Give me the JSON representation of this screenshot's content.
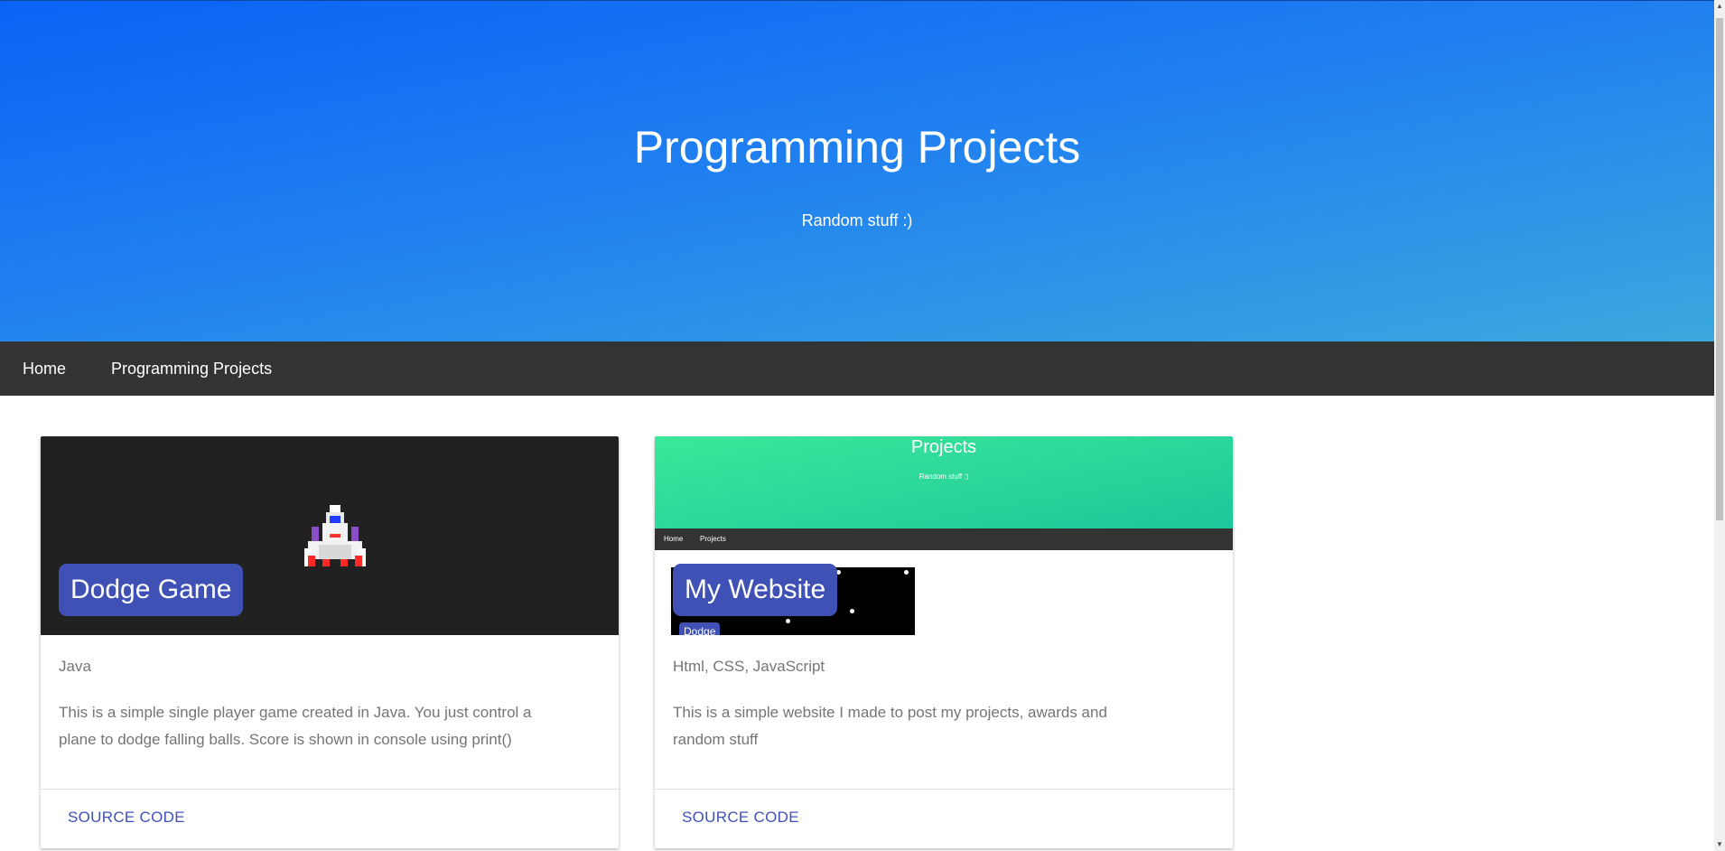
{
  "hero": {
    "title": "Programming Projects",
    "subtitle": "Random stuff :)",
    "gradient_colors": [
      "#0a63f5",
      "#3aa8de"
    ]
  },
  "nav": {
    "items": [
      {
        "label": "Home"
      },
      {
        "label": "Programming Projects"
      }
    ]
  },
  "projects": [
    {
      "title": "Dodge Game",
      "languages": "Java",
      "description": "This is a simple single player game created in Java. You just control a plane to dodge falling balls. Score is shown in console using print()",
      "action": "Source Code",
      "media_icon": "pixel-spaceship-icon"
    },
    {
      "title": "My Website",
      "languages": "Html, CSS, JavaScript",
      "description": "This is a simple website I made to post my projects, awards and random stuff",
      "action": "Source Code",
      "preview": {
        "title": "Projects",
        "subtitle": "Random stuff :)",
        "nav_items": [
          "Home",
          "Projects"
        ],
        "badge": "Dodge"
      }
    }
  ],
  "colors": {
    "accent": "#3f51b5",
    "nav_bg": "#333333",
    "text_muted": "#757575"
  }
}
